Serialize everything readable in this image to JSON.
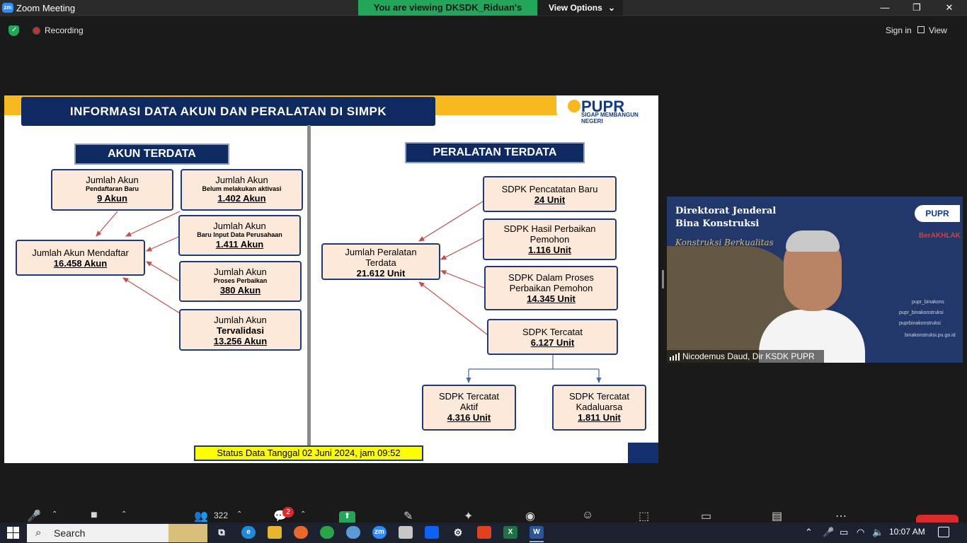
{
  "window": {
    "app_logo": "zm",
    "title": "Zoom Meeting",
    "viewing_banner": "You are viewing DKSDK_Riduan's screen",
    "view_options": "View Options",
    "minimize": "—",
    "restore": "❐",
    "close": "✕"
  },
  "topbar": {
    "recording": "Recording",
    "sign_in": "Sign in",
    "view": "View"
  },
  "slide": {
    "title": "INFORMASI DATA AKUN DAN PERALATAN DI SIMPK",
    "logo_text": "PUPR",
    "logo_tagline": "SIGAP MEMBANGUN NEGERI",
    "akun": {
      "heading": "AKUN TERDATA",
      "pendaftaran": {
        "line1": "Jumlah Akun",
        "sub": "Pendaftaran Baru",
        "value": "9 Akun"
      },
      "belum_aktivasi": {
        "line1": "Jumlah Akun",
        "sub": "Belum melakukan aktivasi",
        "value": "1.402 Akun"
      },
      "mendaftar": {
        "line1": "Jumlah Akun Mendaftar",
        "value": "16.458 Akun"
      },
      "input_perusahaan": {
        "line1": "Jumlah Akun",
        "sub": "Baru Input Data Perusahaan",
        "value": "1.411 Akun"
      },
      "proses": {
        "line1": "Jumlah Akun",
        "sub": "Proses Perbaikan",
        "value": "380 Akun"
      },
      "tervalidasi": {
        "line1": "Jumlah Akun",
        "line2": "Tervalidasi",
        "value": "13.256 Akun"
      }
    },
    "peralatan": {
      "heading": "PERALATAN TERDATA",
      "total": {
        "line1": "Jumlah Peralatan",
        "line2": "Terdata",
        "value": "21.612 Unit"
      },
      "pencatatan_baru": {
        "line1": "SDPK Pencatatan Baru",
        "value": "24 Unit"
      },
      "hasil_perbaikan": {
        "line1": "SDPK Hasil Perbaikan",
        "line2": "Pemohon",
        "value": "1.116 Unit"
      },
      "dalam_proses": {
        "line1": "SDPK Dalam Proses",
        "line2": "Perbaikan Pemohon",
        "value": "14.345 Unit"
      },
      "tercatat": {
        "line1": "SDPK Tercatat",
        "value": "6.127 Unit"
      },
      "aktif": {
        "line1": "SDPK Tercatat",
        "line2": "Aktif",
        "value": "4.316 Unit"
      },
      "kadaluarsa": {
        "line1": "SDPK Tercatat",
        "line2": "Kadaluarsa",
        "value": "1.811 Unit"
      }
    },
    "status": "Status Data Tanggal 02 Juni 2024, jam 09:52"
  },
  "video": {
    "heading1": "Direktorat Jenderal",
    "heading2": "Bina Konstruksi",
    "script": "Konstruksi Berkualitas",
    "logo": "PUPR",
    "akhlak": "BerAKHLAK",
    "social": [
      "pupr_binakons",
      "pupr_binakonstruksi",
      "puprbinakonstruksi",
      "binakonstruksi.pu.go.id"
    ],
    "participant_name": "Nicodemus Daud, Dir KSDK PUPR"
  },
  "toolbar": {
    "participants_count": "322",
    "chat_badge": "2"
  },
  "taskbar": {
    "search_placeholder": "Search",
    "time": "10:07 AM",
    "apps": [
      "edge-icon",
      "explorer-icon",
      "firefox-icon",
      "chrome-icon",
      "paint-icon",
      "zoom-icon",
      "weather-icon",
      "dropbox-icon",
      "settings-icon",
      "acrobat-icon",
      "excel-icon",
      "word-icon"
    ]
  }
}
